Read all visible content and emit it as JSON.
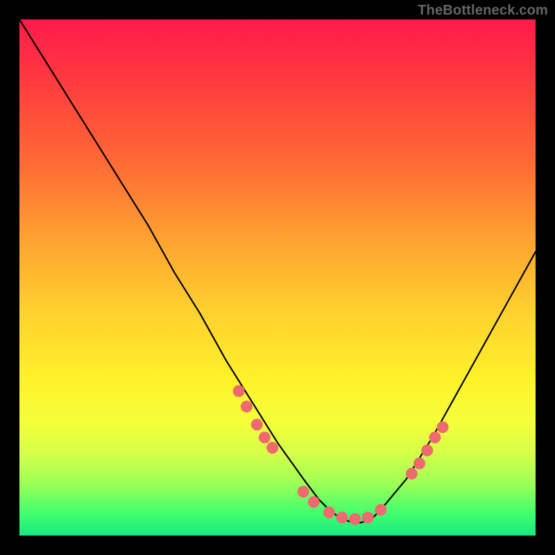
{
  "watermark": "TheBottleneck.com",
  "chart_data": {
    "type": "line",
    "title": "",
    "xlabel": "",
    "ylabel": "",
    "xlim": [
      0,
      100
    ],
    "ylim": [
      0,
      100
    ],
    "grid": false,
    "legend": false,
    "series": [
      {
        "name": "bottleneck-curve",
        "x": [
          0,
          5,
          10,
          15,
          20,
          25,
          30,
          35,
          40,
          45,
          50,
          55,
          58,
          60,
          62,
          64,
          66,
          68,
          70,
          75,
          80,
          85,
          90,
          95,
          100
        ],
        "y": [
          100,
          92,
          84,
          76,
          68,
          60,
          51,
          43,
          34,
          26,
          18,
          11,
          7,
          5,
          3.5,
          2.7,
          2.5,
          3,
          5,
          11,
          19,
          28,
          37,
          46,
          55
        ],
        "stroke": "#000000",
        "stroke_width": 2.2
      }
    ],
    "markers": [
      {
        "name": "bottleneck-markers",
        "color": "#ef6a6f",
        "radius": 8.5,
        "points": [
          {
            "x": 42.5,
            "y": 28
          },
          {
            "x": 44,
            "y": 25
          },
          {
            "x": 46,
            "y": 21.5
          },
          {
            "x": 47.5,
            "y": 19
          },
          {
            "x": 49,
            "y": 17
          },
          {
            "x": 55,
            "y": 8.5
          },
          {
            "x": 57,
            "y": 6.5
          },
          {
            "x": 60,
            "y": 4.5
          },
          {
            "x": 62.5,
            "y": 3.5
          },
          {
            "x": 65,
            "y": 3.2
          },
          {
            "x": 67.5,
            "y": 3.5
          },
          {
            "x": 70,
            "y": 5
          },
          {
            "x": 76,
            "y": 12
          },
          {
            "x": 77.5,
            "y": 14
          },
          {
            "x": 79,
            "y": 16.5
          },
          {
            "x": 80.5,
            "y": 19
          },
          {
            "x": 82,
            "y": 21
          }
        ]
      }
    ]
  }
}
